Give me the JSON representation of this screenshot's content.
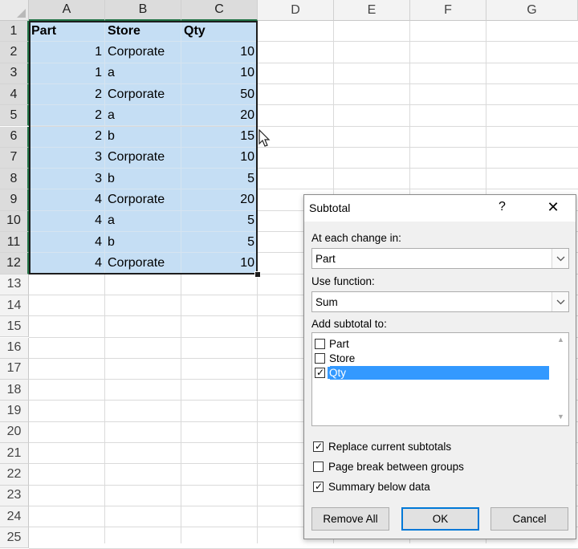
{
  "columns": [
    "A",
    "B",
    "C",
    "D",
    "E",
    "F",
    "G"
  ],
  "row_numbers": [
    "1",
    "2",
    "3",
    "4",
    "5",
    "6",
    "7",
    "8",
    "9",
    "10",
    "11",
    "12",
    "13",
    "14",
    "15",
    "16",
    "17",
    "18",
    "19",
    "20",
    "21",
    "22",
    "23",
    "24",
    "25"
  ],
  "headers": [
    "Part",
    "Store",
    "Qty"
  ],
  "rows": [
    {
      "part": "1",
      "store": "Corporate",
      "qty": "10"
    },
    {
      "part": "1",
      "store": "a",
      "qty": "10"
    },
    {
      "part": "2",
      "store": "Corporate",
      "qty": "50"
    },
    {
      "part": "2",
      "store": "a",
      "qty": "20"
    },
    {
      "part": "2",
      "store": "b",
      "qty": "15"
    },
    {
      "part": "3",
      "store": "Corporate",
      "qty": "10"
    },
    {
      "part": "3",
      "store": "b",
      "qty": "5"
    },
    {
      "part": "4",
      "store": "Corporate",
      "qty": "20"
    },
    {
      "part": "4",
      "store": "a",
      "qty": "5"
    },
    {
      "part": "4",
      "store": "b",
      "qty": "5"
    },
    {
      "part": "4",
      "store": "Corporate",
      "qty": "10"
    }
  ],
  "selection": "A1:C12",
  "dialog": {
    "title": "Subtotal",
    "help": "?",
    "close": "✕",
    "at_each_change_label": "At each change in:",
    "at_each_change_value": "Part",
    "use_function_label": "Use function:",
    "use_function_value": "Sum",
    "add_subtotal_label": "Add subtotal to:",
    "list_items": [
      {
        "label": "Part",
        "checked": false
      },
      {
        "label": "Store",
        "checked": false
      },
      {
        "label": "Qty",
        "checked": true
      }
    ],
    "options": [
      {
        "label": "Replace current subtotals",
        "checked": true
      },
      {
        "label": "Page break between groups",
        "checked": false
      },
      {
        "label": "Summary below data",
        "checked": true
      }
    ],
    "remove_all": "Remove All",
    "ok": "OK",
    "cancel": "Cancel"
  },
  "icons": {
    "cursor": "pointer-cursor-icon",
    "dropdown": "chevron-down-icon"
  },
  "colors": {
    "selection_fill": "#c5def4",
    "list_highlight": "#3399ff",
    "header_accent": "#217346"
  }
}
